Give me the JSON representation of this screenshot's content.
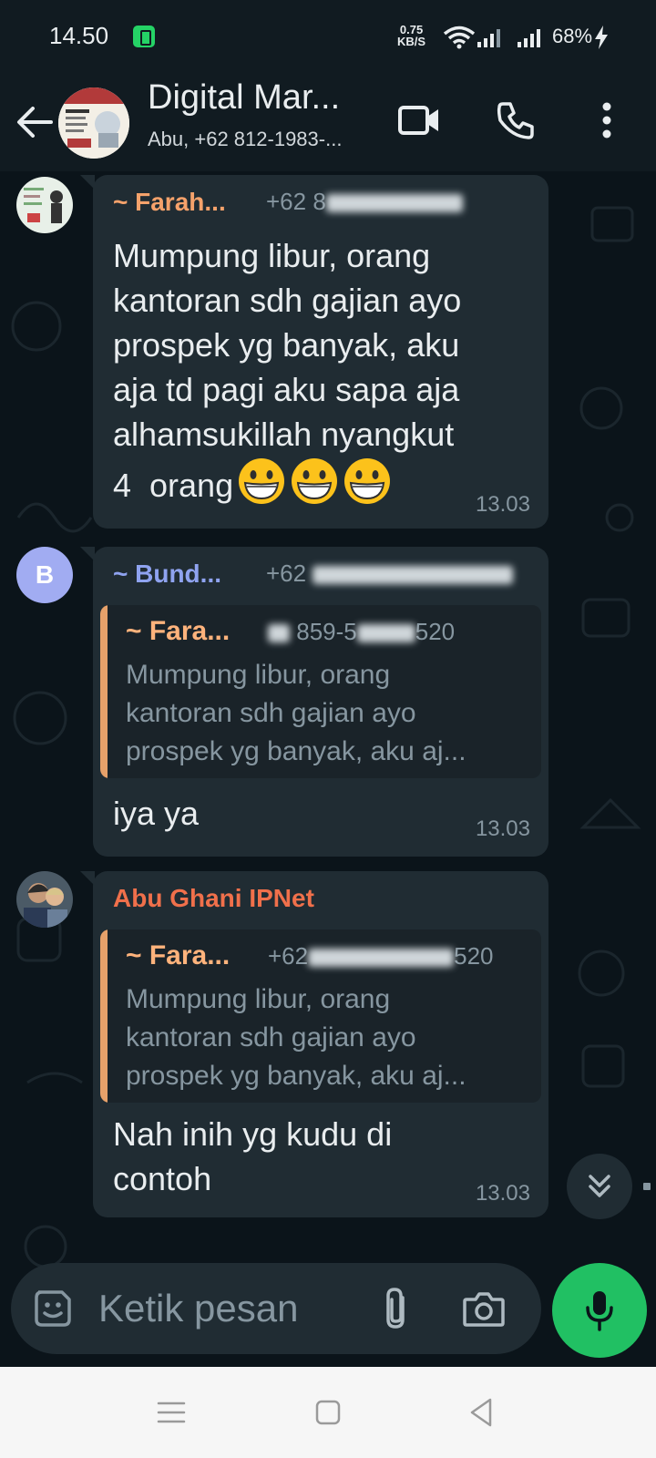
{
  "status_bar": {
    "time": "14.50",
    "speed_value": "0.75",
    "speed_unit": "KB/S",
    "battery": "68%"
  },
  "header": {
    "title": "Digital Mar...",
    "subtitle": "Abu, +62 812-1983-...",
    "avatar_icon": "group-avatar-image"
  },
  "messages": [
    {
      "sender": "~ Farah...",
      "sender_color": "#f5a26b",
      "phone": "+62 8",
      "lines": [
        "Mumpung libur, orang",
        "kantoran sdh gajian ayo",
        "prospek yg banyak, aku",
        "aja td pagi aku sapa aja",
        "alhamsukillah nyangkut",
        "4  orang"
      ],
      "emoji": "grinning-face",
      "time": "13.03"
    },
    {
      "sender": "~ Bund...",
      "sender_color": "#8fa3f0",
      "avatar_letter": "B",
      "avatar_color": "#a1acf2",
      "phone": "+62",
      "quote": {
        "name": "~ Fara...",
        "phone": "859-5",
        "phone_tail": "520",
        "lines": [
          "Mumpung libur, orang",
          "kantoran sdh gajian ayo",
          "prospek yg banyak, aku aj..."
        ]
      },
      "text": "iya ya",
      "time": "13.03"
    },
    {
      "sender": "Abu Ghani IPNet",
      "sender_color": "#f0704b",
      "quote": {
        "name": "~ Fara...",
        "phone": "+62",
        "phone_tail": "520",
        "lines": [
          "Mumpung libur, orang",
          "kantoran sdh gajian ayo",
          "prospek yg banyak, aku aj..."
        ]
      },
      "lines": [
        "Nah inih yg kudu di",
        "contoh"
      ],
      "time": "13.03"
    }
  ],
  "composer": {
    "placeholder": "Ketik pesan"
  },
  "colors": {
    "accent": "#21c063",
    "bubble": "#202c33",
    "background": "#0b141a"
  }
}
